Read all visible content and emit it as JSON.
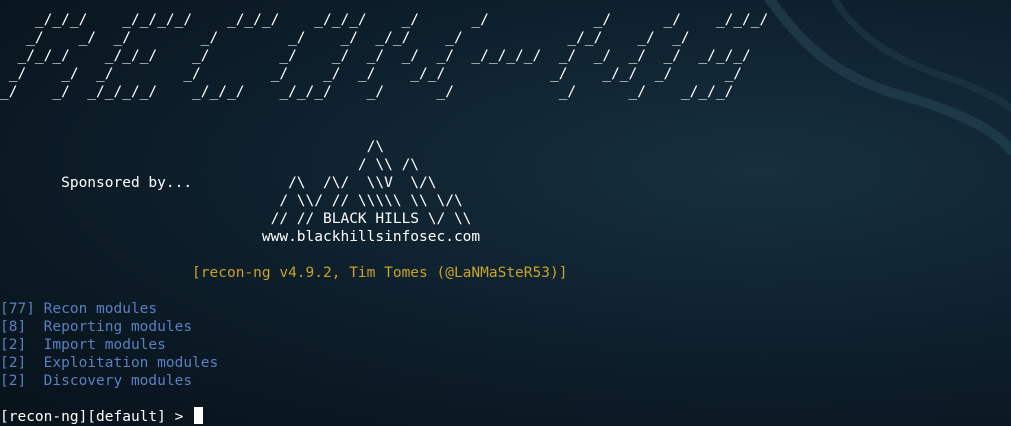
{
  "banner": {
    "ascii_lines": [
      "    _/_/_/    _/_/_/_/    _/_/_/    _/_/_/    _/      _/            _/      _/    _/_/_/",
      "   _/    _/  _/        _/        _/    _/  _/_/    _/            _/_/    _/  _/",
      "  _/_/_/    _/_/_/    _/        _/    _/  _/  _/  _/  _/_/_/_/  _/  _/  _/  _/  _/_/_/",
      " _/    _/  _/        _/        _/    _/  _/    _/_/            _/    _/_/  _/      _/",
      "_/    _/  _/_/_/_/    _/_/_/    _/_/_/    _/      _/            _/      _/    _/_/_/"
    ]
  },
  "sponsor": {
    "lines": [
      "                                          /\\",
      "                                         / \\\\ /\\",
      "       Sponsored by...           /\\  /\\/  \\\\V  \\/\\",
      "                                / \\\\/ // \\\\\\\\\\ \\\\ \\/\\",
      "                               // // BLACK HILLS \\/ \\\\",
      "                              www.blackhillsinfosec.com"
    ]
  },
  "version_line": "                      [recon-ng v4.9.2, Tim Tomes (@LaNMaSteR53)]",
  "modules": [
    "[77] Recon modules",
    "[8]  Reporting modules",
    "[2]  Import modules",
    "[2]  Exploitation modules",
    "[2]  Discovery modules"
  ],
  "prompt": "[recon-ng][default] > "
}
